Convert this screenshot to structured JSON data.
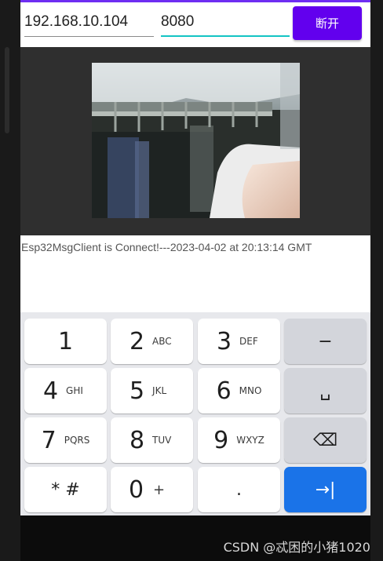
{
  "connection": {
    "ip_value": "192.168.10.104",
    "port_value": "8080",
    "disconnect_label": "断开"
  },
  "log": {
    "message": "Esp32MsgClient is Connect!---2023-04-02 at 20:13:14 GMT"
  },
  "keypad": {
    "keys": [
      {
        "main": "1",
        "sub": ""
      },
      {
        "main": "2",
        "sub": "ABC"
      },
      {
        "main": "3",
        "sub": "DEF"
      },
      {
        "main": "−",
        "sub": ""
      },
      {
        "main": "4",
        "sub": "GHI"
      },
      {
        "main": "5",
        "sub": "JKL"
      },
      {
        "main": "6",
        "sub": "MNO"
      },
      {
        "main": "␣",
        "sub": ""
      },
      {
        "main": "7",
        "sub": "PQRS"
      },
      {
        "main": "8",
        "sub": "TUV"
      },
      {
        "main": "9",
        "sub": "WXYZ"
      },
      {
        "main": "⌫",
        "sub": ""
      },
      {
        "main": "* #",
        "sub": ""
      },
      {
        "main": "0",
        "sub": "+"
      },
      {
        "main": ".",
        "sub": ""
      },
      {
        "main": "→|",
        "sub": ""
      }
    ]
  },
  "watermark": "CSDN @忒困的小猪1020",
  "colors": {
    "accent": "#6200ee",
    "port_underline": "#14c4c4",
    "enter_key": "#1a73e8",
    "video_bg": "#2f2f2f"
  }
}
